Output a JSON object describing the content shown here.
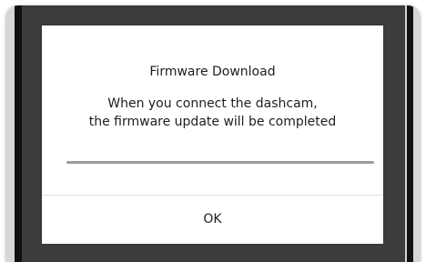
{
  "dialog": {
    "title": "Firmware Download",
    "message_lines": [
      "When you connect the dashcam,",
      "the firmware update will be completed"
    ],
    "progress": 1.0,
    "ok_label": "OK"
  },
  "colors": {
    "overlay": "#3c3c3c",
    "dialog_bg": "#ffffff",
    "progress_fill": "#9a9a9a",
    "text": "#1e1e1e"
  }
}
